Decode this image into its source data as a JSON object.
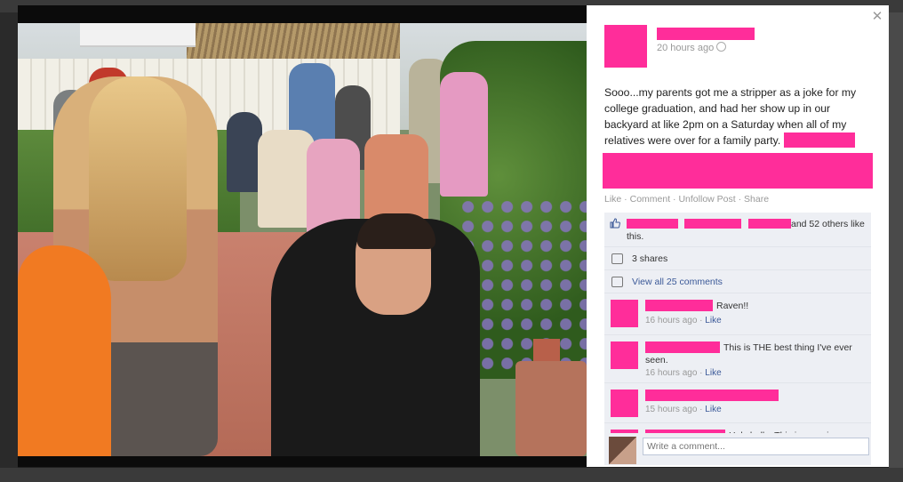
{
  "post": {
    "timestamp": "20 hours ago",
    "body": "Sooo...my parents got me a stripper as a joke for my college graduation, and had her show up in our backyard at like 2pm on a Saturday when all of my relatives were over for a family party.",
    "actions": [
      "Like",
      "Comment",
      "Unfollow Post",
      "Share"
    ]
  },
  "ufi": {
    "likes_tail": "and 52 others like this.",
    "shares": "3 shares",
    "view_all": "View all 25 comments"
  },
  "comments": [
    {
      "text": "Raven!!",
      "meta_time": "16 hours ago",
      "meta_like": "Like"
    },
    {
      "text": "This is THE best thing I've ever seen.",
      "meta_time": "16 hours ago",
      "meta_like": "Like"
    },
    {
      "text": "",
      "meta_time": "15 hours ago",
      "meta_like": "Like"
    },
    {
      "text": "Holy balls. This is amazing.",
      "meta_time": "",
      "meta_like": ""
    }
  ],
  "composer": {
    "placeholder": "Write a comment..."
  },
  "icons": {
    "close": "close-icon",
    "audience": "globe-icon",
    "like": "thumbs-up-icon",
    "share": "share-icon",
    "comment": "comment-icon"
  },
  "colors": {
    "redaction": "#ff2d9a",
    "link": "#3b5998",
    "ufi_bg": "#edeff4"
  }
}
